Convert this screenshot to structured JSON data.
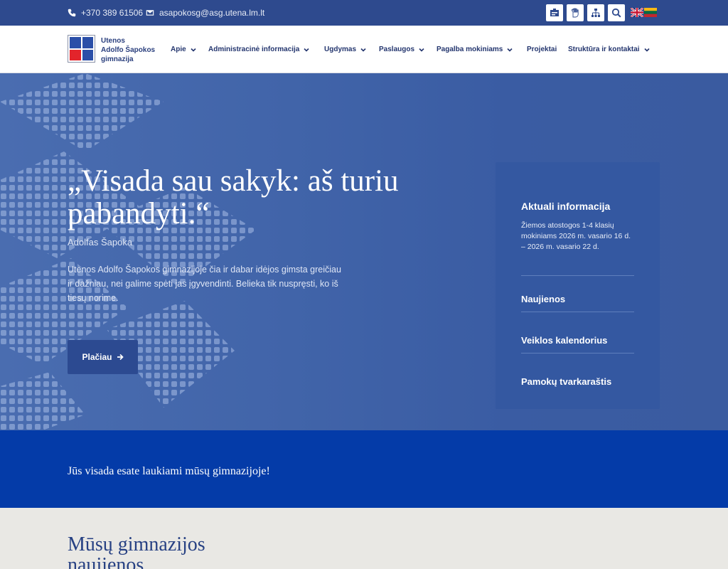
{
  "topbar": {
    "phone": "+370 389 61506",
    "email": "asapokosg@asg.utena.lm.lt",
    "tools": [
      "easy-read-icon",
      "sign-language-icon",
      "sitemap-icon",
      "search-icon"
    ],
    "languages": [
      "English",
      "Lietuvių"
    ]
  },
  "header": {
    "logo": {
      "line1": "Utenos",
      "line2": "Adolfo Šapokos",
      "line3": "gimnazija"
    },
    "nav": [
      {
        "label": "Apie",
        "dropdown": true
      },
      {
        "label": "Administracinė informacija",
        "dropdown": true
      },
      {
        "label": "Ugdymas",
        "dropdown": true
      },
      {
        "label": "Paslaugos",
        "dropdown": true
      },
      {
        "label": "Pagalba mokiniams",
        "dropdown": true
      },
      {
        "label": "Projektai",
        "dropdown": false
      },
      {
        "label": "Struktūra ir kontaktai",
        "dropdown": true
      }
    ]
  },
  "hero": {
    "quote_line1": "„Visada sau sakyk: aš turiu",
    "quote_line2": "pabandyti.“",
    "author": "Adolfas Šapoka",
    "description": "Utenos Adolfo Šapokos gimnazijoje čia ir dabar idėjos gimsta greičiau ir dažniau, nei galime spėti jas įgyvendinti. Belieka tik nuspręsti, ko iš tiesų norime.",
    "button_label": "Plačiau"
  },
  "info_panel": {
    "title": "Aktuali informacija",
    "text": "Žiemos atostogos 1-4 klasių mokiniams 2026 m. vasario 16 d. – 2026 m. vasario 22 d.",
    "links": [
      "Naujienos",
      "Veiklos kalendorius",
      "Pamokų tvarkaraštis"
    ]
  },
  "welcome": {
    "text": "Jūs visada esate laukiami mūsų gimnazijoje!"
  },
  "news": {
    "title": "Mūsų gimnazijos naujienos"
  },
  "colors": {
    "topbar": "#2e4a8e",
    "nav_text": "#23356e",
    "hero": "#4164a9",
    "panel": "#3458a1",
    "welcome_band": "#043ba8",
    "news_bg": "#e9e8e4",
    "news_title": "#274183",
    "logo_blue": "#2b4fa8",
    "logo_red": "#e3242b"
  }
}
